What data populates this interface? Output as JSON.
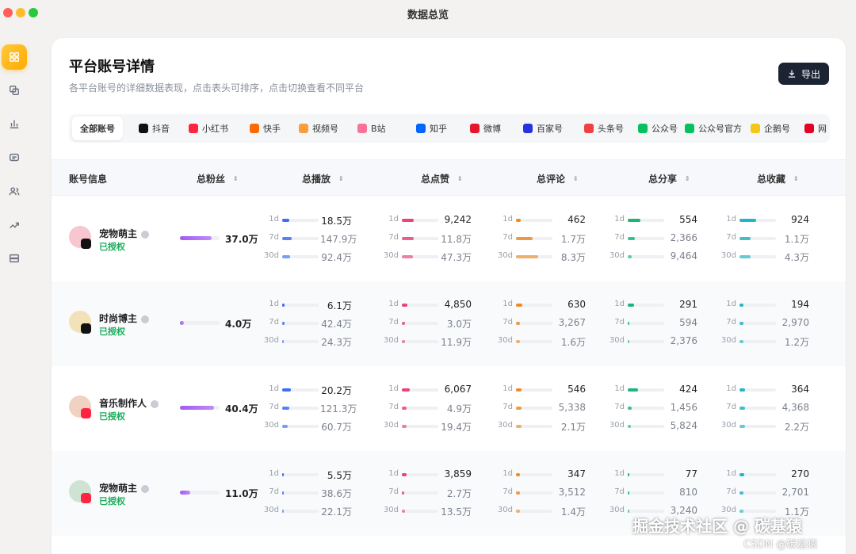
{
  "window": {
    "title": "数据总览"
  },
  "sidebar": {
    "items": [
      {
        "icon": "grid-icon",
        "active": true
      },
      {
        "icon": "copy-icon",
        "active": false
      },
      {
        "icon": "bar-chart-icon",
        "active": false
      },
      {
        "icon": "message-icon",
        "active": false
      },
      {
        "icon": "users-icon",
        "active": false
      },
      {
        "icon": "trend-icon",
        "active": false
      },
      {
        "icon": "database-icon",
        "active": false
      }
    ]
  },
  "header": {
    "title": "平台账号详情",
    "subtitle": "各平台账号的详细数据表现，点击表头可排序，点击切换查看不同平台",
    "export_label": "导出"
  },
  "tabs": [
    {
      "label": "全部账号",
      "icon": "",
      "color": ""
    },
    {
      "label": "抖音",
      "icon": "douyin-icon",
      "color": "#111111"
    },
    {
      "label": "小红书",
      "icon": "xiaohongshu-icon",
      "color": "#ff2442"
    },
    {
      "label": "快手",
      "icon": "kuaishou-icon",
      "color": "#ff6a00"
    },
    {
      "label": "视频号",
      "icon": "shipinhao-icon",
      "color": "#fa9d3b"
    },
    {
      "label": "B站",
      "icon": "bilibili-icon",
      "color": "#fb7299"
    },
    {
      "label": "知乎",
      "icon": "zhihu-icon",
      "color": "#0066ff"
    },
    {
      "label": "微博",
      "icon": "weibo-icon",
      "color": "#e6162d"
    },
    {
      "label": "百家号",
      "icon": "baijiahao-icon",
      "color": "#2932e1"
    },
    {
      "label": "头条号",
      "icon": "toutiao-icon",
      "color": "#f04142"
    },
    {
      "label": "公众号",
      "icon": "gongzhonghao-icon",
      "color": "#07c160"
    },
    {
      "label": "公众号官方",
      "icon": "gongzhonghao-official-icon",
      "color": "#07c160"
    },
    {
      "label": "企鹅号",
      "icon": "qiehao-icon",
      "color": "#f5c518"
    },
    {
      "label": "网",
      "icon": "netease-icon",
      "color": "#e60026"
    }
  ],
  "table": {
    "columns": [
      "账号信息",
      "总粉丝",
      "总播放",
      "总点赞",
      "总评论",
      "总分享",
      "总收藏"
    ],
    "period_labels": [
      "1d",
      "7d",
      "30d"
    ],
    "metric_colors": {
      "play": "#3b6ff5",
      "like": "#e8447a",
      "comment": "#f08a24",
      "share": "#1bb57a",
      "collect": "#22b5c3"
    },
    "rows": [
      {
        "name": "宠物萌主",
        "status": "已授权",
        "platform": "douyin",
        "avatar": "#f7c6d0",
        "fans": "37.0万",
        "fans_level": 0.8,
        "play": [
          "18.5万",
          "147.9万",
          "92.4万"
        ],
        "play_level": [
          0.2,
          0.25,
          0.22
        ],
        "like": [
          "9,242",
          "11.8万",
          "47.3万"
        ],
        "like_level": [
          0.33,
          0.33,
          0.3
        ],
        "comment": [
          "462",
          "1.7万",
          "8.3万"
        ],
        "comment_level": [
          0.12,
          0.45,
          0.6
        ],
        "share": [
          "554",
          "2,366",
          "9,464"
        ],
        "share_level": [
          0.35,
          0.2,
          0.1
        ],
        "collect": [
          "924",
          "1.1万",
          "4.3万"
        ],
        "collect_level": [
          0.45,
          0.3,
          0.3
        ]
      },
      {
        "name": "时尚博主",
        "status": "已授权",
        "platform": "douyin",
        "avatar": "#f3e2b8",
        "fans": "4.0万",
        "fans_level": 0.1,
        "play": [
          "6.1万",
          "42.4万",
          "24.3万"
        ],
        "play_level": [
          0.06,
          0.06,
          0.05
        ],
        "like": [
          "4,850",
          "3.0万",
          "11.9万"
        ],
        "like_level": [
          0.15,
          0.08,
          0.08
        ],
        "comment": [
          "630",
          "3,267",
          "1.6万"
        ],
        "comment_level": [
          0.18,
          0.1,
          0.1
        ],
        "share": [
          "291",
          "594",
          "2,376"
        ],
        "share_level": [
          0.18,
          0.05,
          0.04
        ],
        "collect": [
          "194",
          "2,970",
          "1.2万"
        ],
        "collect_level": [
          0.1,
          0.1,
          0.1
        ]
      },
      {
        "name": "音乐制作人",
        "status": "已授权",
        "platform": "xiaohongshu",
        "avatar": "#f1d1c2",
        "fans": "40.4万",
        "fans_level": 0.85,
        "play": [
          "20.2万",
          "121.3万",
          "60.7万"
        ],
        "play_level": [
          0.24,
          0.2,
          0.16
        ],
        "like": [
          "6,067",
          "4.9万",
          "19.4万"
        ],
        "like_level": [
          0.22,
          0.12,
          0.12
        ],
        "comment": [
          "546",
          "5,338",
          "2.1万"
        ],
        "comment_level": [
          0.16,
          0.15,
          0.15
        ],
        "share": [
          "424",
          "1,456",
          "5,824"
        ],
        "share_level": [
          0.28,
          0.1,
          0.08
        ],
        "collect": [
          "364",
          "4,368",
          "2.2万"
        ],
        "collect_level": [
          0.16,
          0.16,
          0.16
        ]
      },
      {
        "name": "宠物萌主",
        "status": "已授权",
        "platform": "xiaohongshu",
        "avatar": "#cfe3d2",
        "fans": "11.0万",
        "fans_level": 0.25,
        "play": [
          "5.5万",
          "38.6万",
          "22.1万"
        ],
        "play_level": [
          0.05,
          0.05,
          0.05
        ],
        "like": [
          "3,859",
          "2.7万",
          "13.5万"
        ],
        "like_level": [
          0.12,
          0.07,
          0.08
        ],
        "comment": [
          "347",
          "3,512",
          "1.4万"
        ],
        "comment_level": [
          0.1,
          0.1,
          0.1
        ],
        "share": [
          "77",
          "810",
          "3,240"
        ],
        "share_level": [
          0.04,
          0.04,
          0.04
        ],
        "collect": [
          "270",
          "2,701",
          "1.1万"
        ],
        "collect_level": [
          0.13,
          0.1,
          0.1
        ]
      }
    ]
  },
  "watermark": {
    "line1": "掘金技术社区 @ 碳基猿",
    "line2": "CSDN @碳基猿"
  }
}
